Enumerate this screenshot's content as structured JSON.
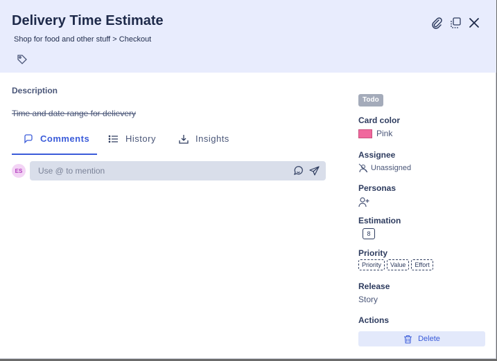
{
  "card": {
    "title": "Delivery Time Estimate",
    "breadcrumb": "Shop for food and other stuff > Checkout"
  },
  "description": {
    "label": "Description",
    "text": "Time and date range for delievery"
  },
  "tabs": [
    {
      "label": "Comments",
      "icon": "comments-icon",
      "active": true
    },
    {
      "label": "History",
      "icon": "list-icon",
      "active": false
    },
    {
      "label": "Insights",
      "icon": "download-icon",
      "active": false
    }
  ],
  "comment": {
    "avatar_initials": "ES",
    "placeholder": "Use @ to mention"
  },
  "sidebar": {
    "status": "Todo",
    "card_color_label": "Card color",
    "card_color_value": "Pink",
    "card_color_hex": "#f0689d",
    "assignee_label": "Assignee",
    "assignee_value": "Unassigned",
    "personas_label": "Personas",
    "estimation_label": "Estimation",
    "estimation_value": "8",
    "priority_label": "Priority",
    "priority_chips": [
      "Priority",
      "Value",
      "Effort"
    ],
    "release_label": "Release",
    "release_value": "Story",
    "actions_label": "Actions",
    "delete_label": "Delete"
  },
  "colors": {
    "header_bg": "#e8ecfd",
    "accent": "#3a5bd9"
  }
}
